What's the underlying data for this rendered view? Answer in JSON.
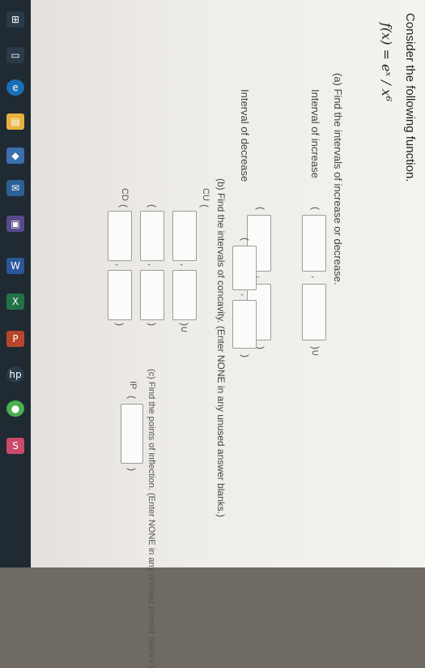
{
  "taskbar": {
    "icons": [
      "windows-icon",
      "task-view-icon",
      "edge-icon",
      "file-explorer-icon",
      "store-icon",
      "mail-icon",
      "app-icon",
      "word-icon",
      "excel-icon",
      "powerpoint-icon",
      "hp-icon",
      "chrome-icon",
      "sticky-icon"
    ]
  },
  "question": {
    "intro": "Consider the following function.",
    "function": "f(x) = eˣ / x⁶",
    "part_a": "(a) Find the intervals of increase or decrease.",
    "increase_label": "Interval of increase",
    "decrease_label": "Interval of decrease",
    "part_b": "(b) Find the intervals of concavity. (Enter NONE in any unused answer blanks.)",
    "cu_label": "CU",
    "cd_label": "CD",
    "part_c": "(c) Find the points of inflection. (Enter NONE in any unused answer blanks.)",
    "ip_label": "IP",
    "open_paren": "(",
    "close_paren": ")",
    "union": ")∪",
    "comma": ","
  }
}
